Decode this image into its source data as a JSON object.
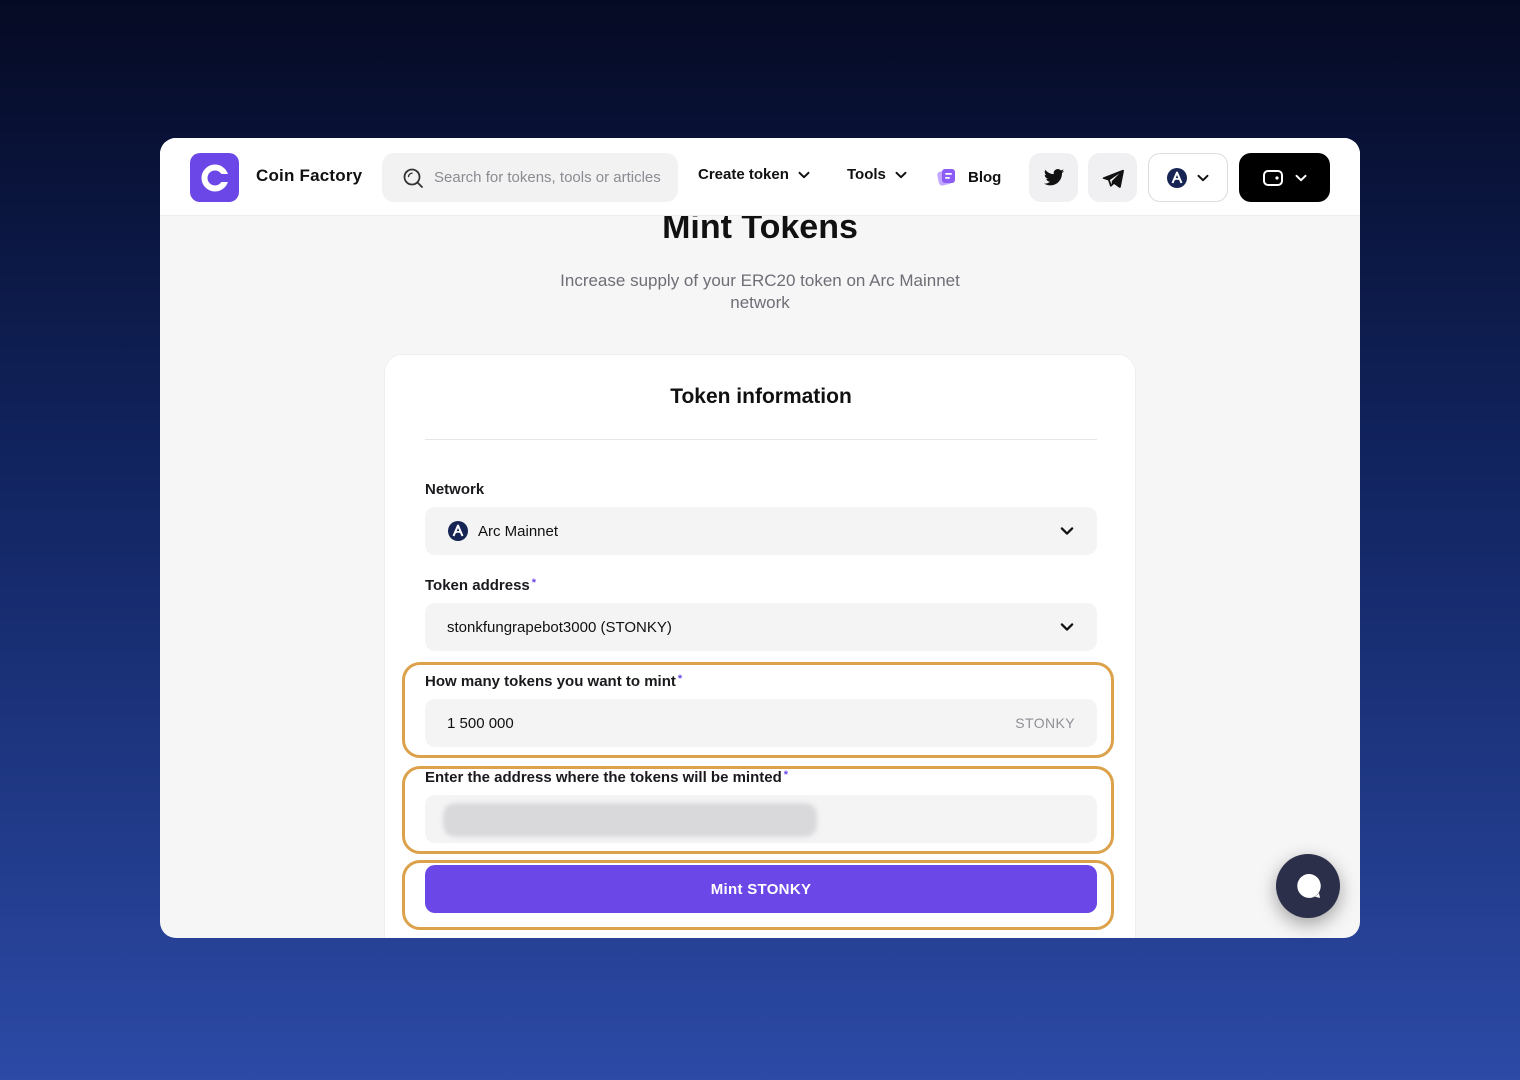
{
  "app": {
    "logo_letter": "C",
    "brand_name": "Coin Factory"
  },
  "header": {
    "search_placeholder": "Search for tokens, tools or articles",
    "nav": [
      {
        "label": "Create token",
        "icon": "chevron-down-icon"
      },
      {
        "label": "Tools",
        "icon": "chevron-down-icon"
      },
      {
        "label": "Blog",
        "icon": "blog-icon"
      }
    ],
    "social": [
      "twitter-icon",
      "telegram-icon"
    ],
    "network_icon": "arc-network-icon",
    "wallet_icon": "wallet-icon"
  },
  "page": {
    "title": "Mint Tokens",
    "subtitle": "Increase supply of your ERC20 token on Arc Mainnet network"
  },
  "form": {
    "card_title": "Token information",
    "network_label": "Network",
    "network_value": "Arc Mainnet",
    "token_address_label": "Token address",
    "token_address_value": "stonkfungrapebot3000 (STONKY)",
    "amount_label": "How many tokens you want to mint",
    "amount_value": "1 500 000",
    "amount_suffix": "STONKY",
    "address_label": "Enter the address where the tokens will be minted",
    "required_marker": "*",
    "submit_label": "Mint STONKY"
  },
  "colors": {
    "accent": "#6c47e8",
    "highlight": "#dca24b",
    "wallet_bg": "#000000",
    "chat_bg": "#2c2f4a"
  }
}
